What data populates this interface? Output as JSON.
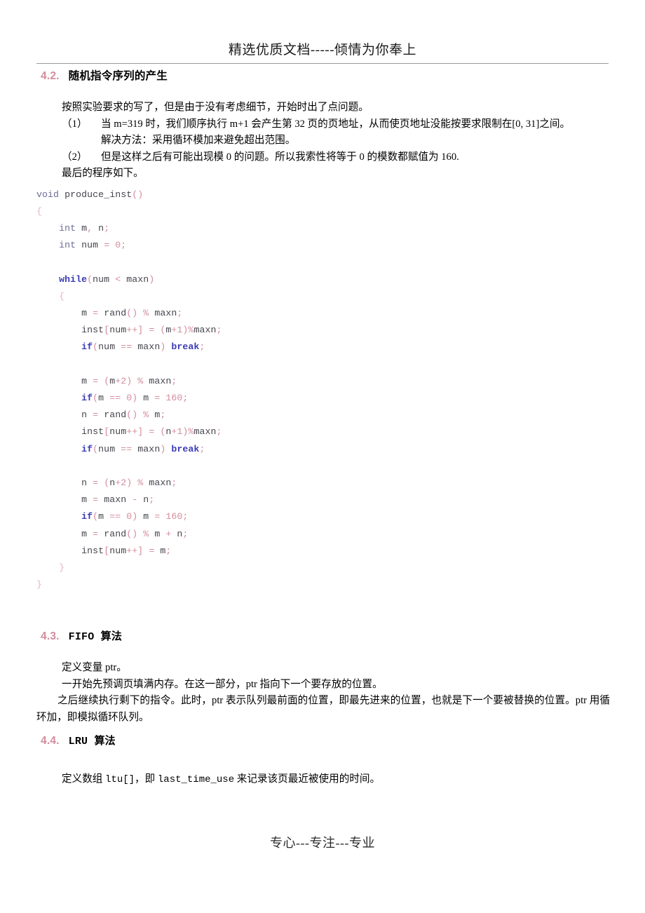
{
  "header": {
    "text": "精选优质文档-----倾情为你奉上"
  },
  "footer": {
    "text": "专心---专注---专业"
  },
  "sections": {
    "s42": {
      "number": "4.2.",
      "title": "随机指令序列的产生",
      "intro": "按照实验要求的写了，但是由于没有考虑细节，开始时出了点问题。",
      "items": [
        {
          "marker": "（1）",
          "text": "当 m=319 时，我们顺序执行 m+1 会产生第 32 页的页地址，从而使页地址没能按要求限制在[0, 31]之间。"
        },
        {
          "marker": "（2）",
          "text": "但是这样之后有可能出现模 0 的问题。所以我索性将等于 0 的模数都赋值为 160."
        }
      ],
      "subnote": "解决方法：采用循环模加来避免超出范围。",
      "closing": "最后的程序如下。"
    },
    "s43": {
      "number": "4.3.",
      "title": "FIFO 算法",
      "paragraphs": [
        "定义变量 ptr。",
        "一开始先预调页填满内存。在这一部分，ptr 指向下一个要存放的位置。",
        "之后继续执行剩下的指令。此时，ptr 表示队列最前面的位置，即最先进来的位置，也就是下一个要被替换的位置。ptr 用循环加，即模拟循环队列。"
      ]
    },
    "s44": {
      "number": "4.4.",
      "title": "LRU 算法",
      "paragraph_parts": {
        "p1": "定义数组 ",
        "code1": "ltu[]",
        "p2": "，即 ",
        "code2": "last_time_use",
        "p3": " 来记录该页最近被使用的时间。"
      }
    }
  },
  "code_listing": {
    "language": "c",
    "lines": [
      "void produce_inst()",
      "{",
      "    int m, n;",
      "    int num = 0;",
      "",
      "    while(num < maxn)",
      "    {",
      "        m = rand() % maxn;",
      "        inst[num++] = (m+1)%maxn;",
      "        if(num == maxn) break;",
      "",
      "        m = (m+2) % maxn;",
      "        if(m == 0) m = 160;",
      "        n = rand() % m;",
      "        inst[num++] = (n+1)%maxn;",
      "        if(num == maxn) break;",
      "",
      "        n = (n+2) % maxn;",
      "        m = maxn - n;",
      "        if(m == 0) m = 160;",
      "        m = rand() % m + n;",
      "        inst[num++] = m;",
      "    }",
      "}"
    ]
  },
  "colors": {
    "keyword": "#3b3bb5",
    "type": "#6b6b96",
    "identifier": "#44444c",
    "punctuation": "#d48c9e",
    "brace": "#e3b6c0",
    "rule": "#9a9a9a"
  }
}
